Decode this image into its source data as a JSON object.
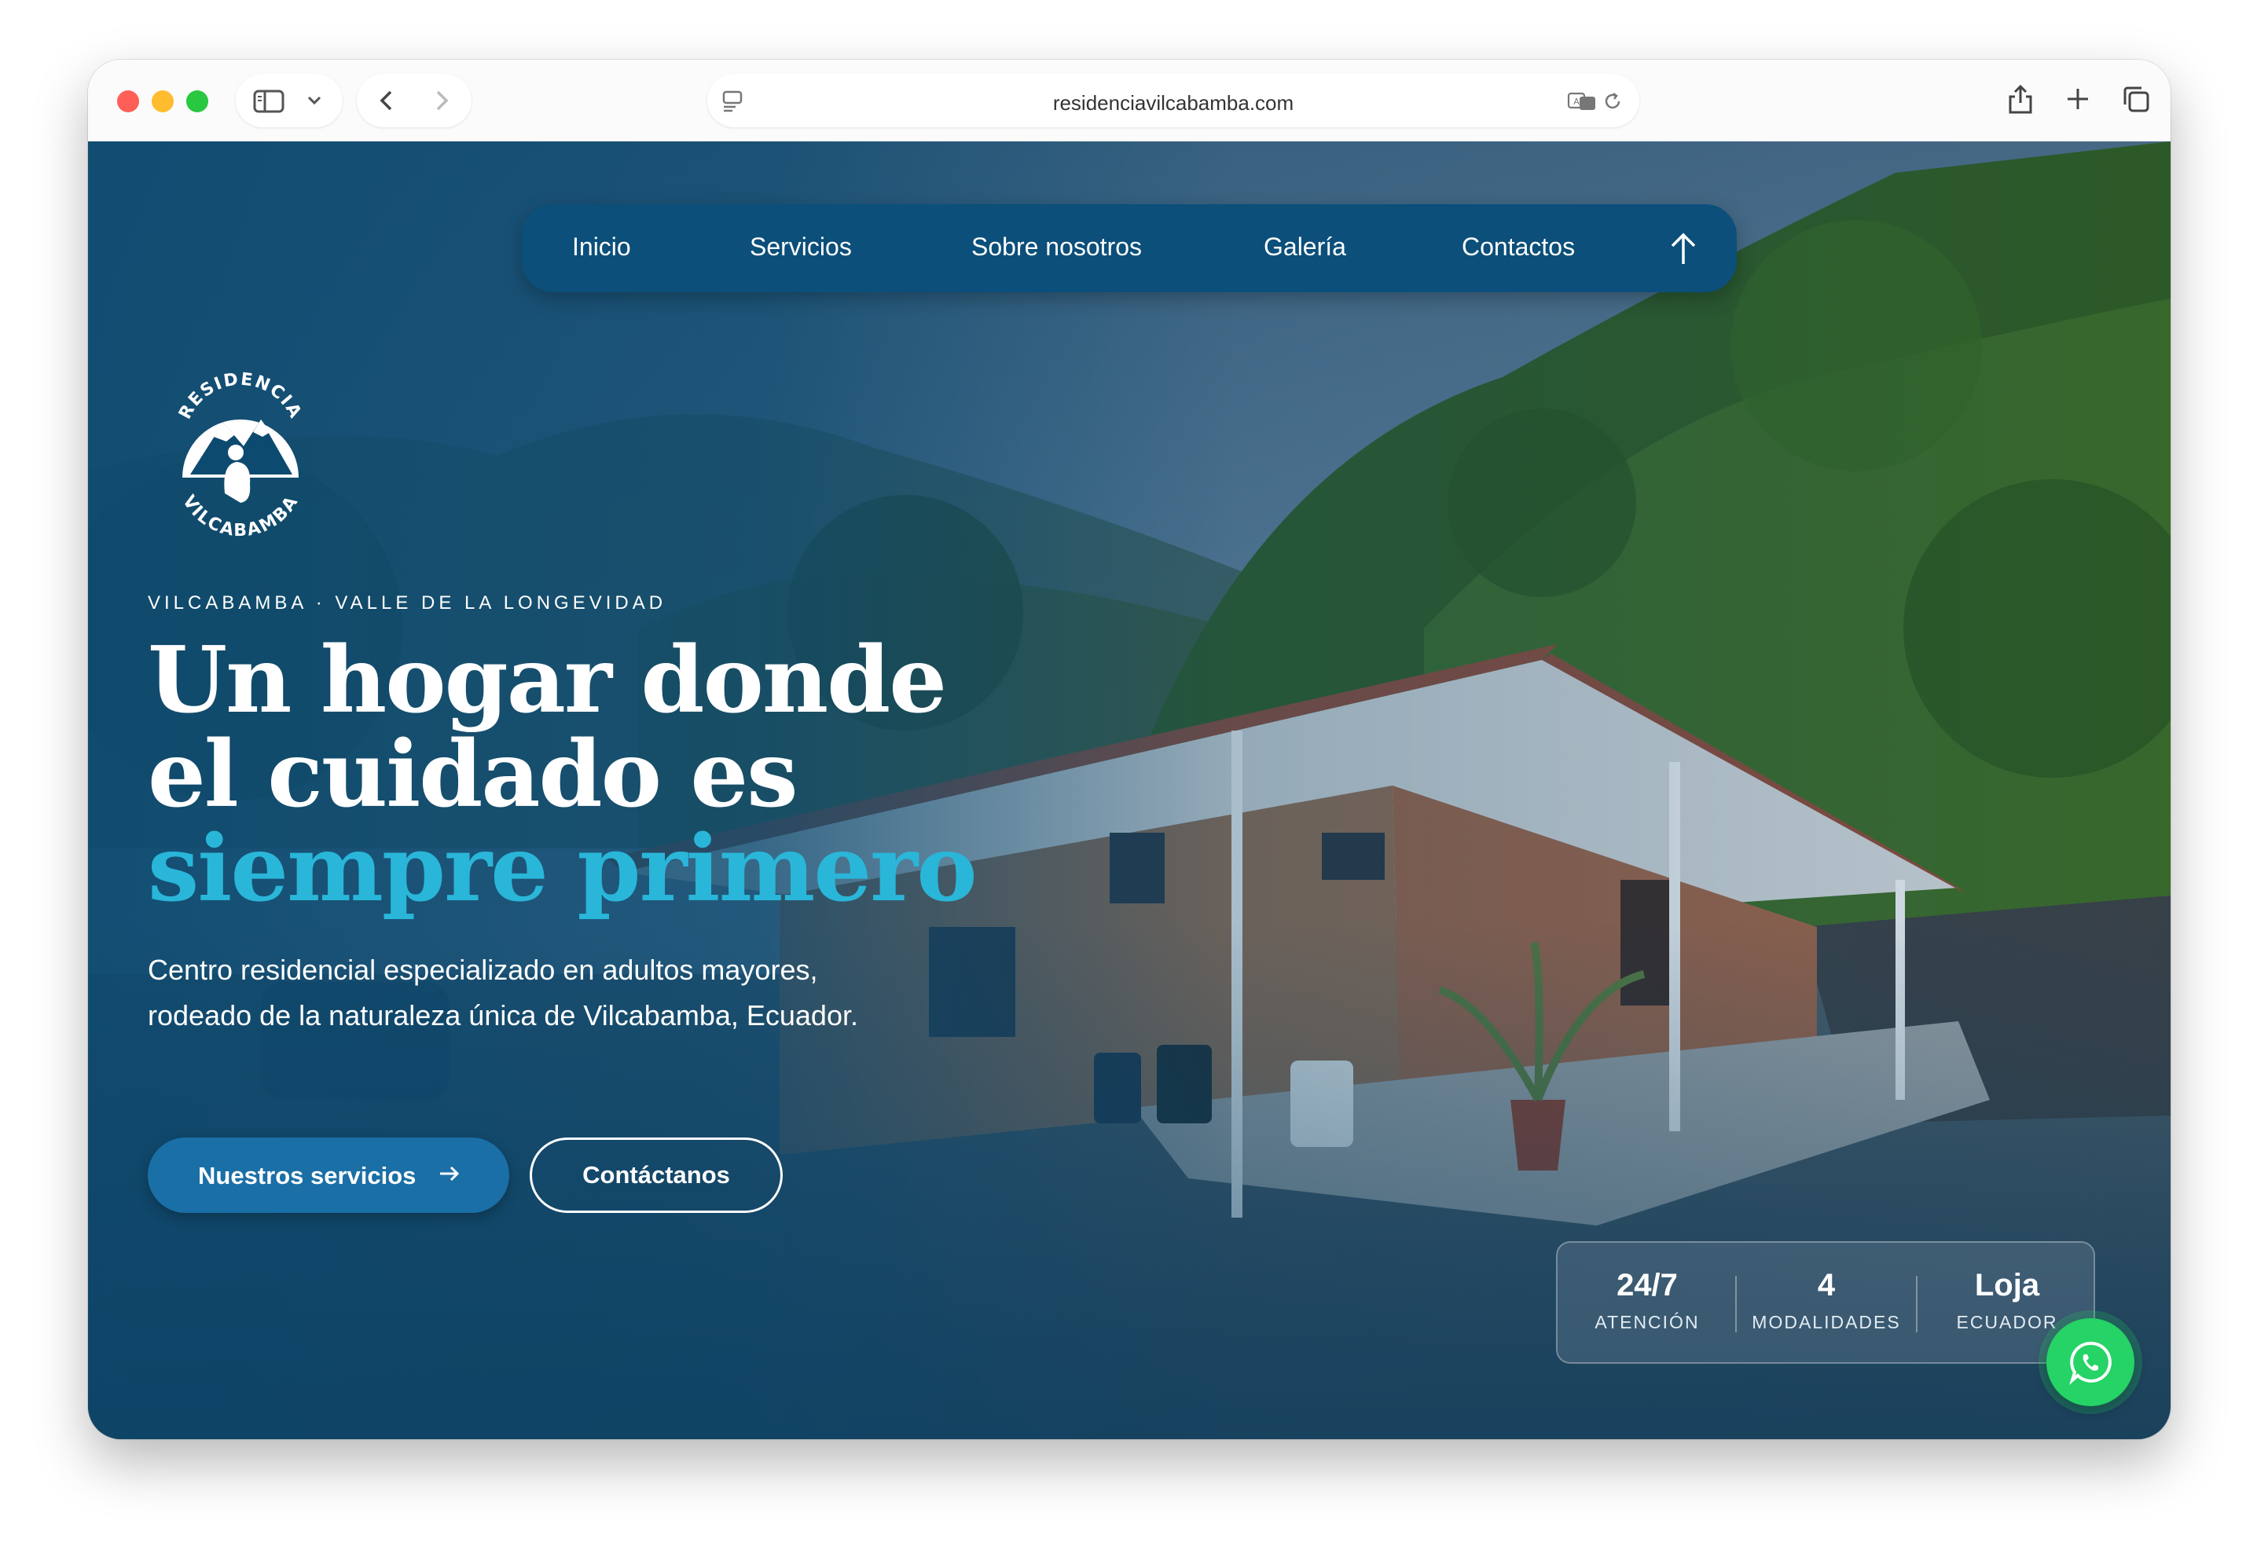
{
  "browser": {
    "url": "residenciavilcabamba.com"
  },
  "nav": {
    "items": [
      "Inicio",
      "Servicios",
      "Sobre nosotros",
      "Galería",
      "Contactos"
    ]
  },
  "logo": {
    "text_top": "RESIDENCIA",
    "text_bottom": "VILCABAMBA"
  },
  "hero": {
    "eyebrow": "VILCABAMBA · VALLE DE LA LONGEVIDAD",
    "headline_line1": "Un hogar donde",
    "headline_line2": "el cuidado es",
    "headline_accent": "siempre primero",
    "subtitle": "Centro residencial especializado en adultos mayores, rodeado de la naturaleza única de Vilcabamba, Ecuador.",
    "primary_cta": "Nuestros servicios",
    "secondary_cta": "Contáctanos"
  },
  "stats": [
    {
      "value": "24/7",
      "label": "ATENCIÓN"
    },
    {
      "value": "4",
      "label": "MODALIDADES"
    },
    {
      "value": "Loja",
      "label": "ECUADOR"
    }
  ],
  "colors": {
    "nav_bg": "#0b4f7a",
    "accent": "#29b6d9",
    "primary_button": "#1a6fa6",
    "whatsapp": "#25d366"
  },
  "icons": {
    "scroll_up": "arrow-up-icon",
    "whatsapp": "whatsapp-icon"
  }
}
